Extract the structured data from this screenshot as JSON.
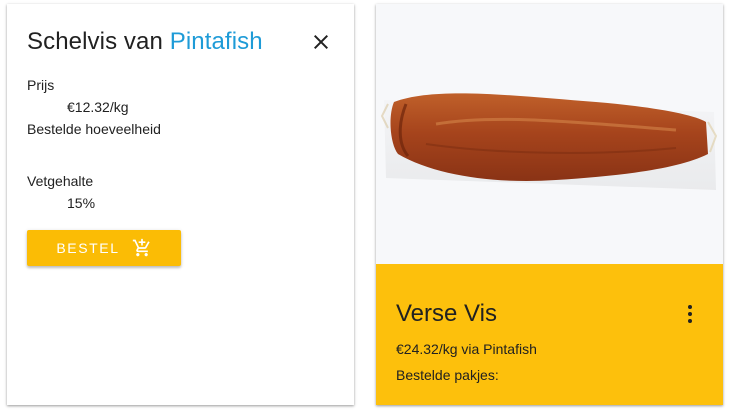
{
  "detail": {
    "title_prefix": "Schelvis van",
    "seller": "Pintafish",
    "price_label": "Prijs",
    "price_value": "€12.32/kg",
    "ordered_label": "Bestelde hoeveelheid",
    "fat_label": "Vetgehalte",
    "fat_value": "15%",
    "order_button_label": "BESTEL",
    "close_icon": "close-icon",
    "cart_icon": "add-shopping-cart-icon"
  },
  "product": {
    "title": "Verse Vis",
    "price_line": "€24.32/kg via Pintafish",
    "ordered_label": "Bestelde pakjes:",
    "menu_icon": "more-vert-icon",
    "image": "smoked-fish-fillet-photo"
  },
  "colors": {
    "accent": "#fbbc05",
    "card_footer": "#fdc00c",
    "seller_link": "#1e9bd7"
  }
}
